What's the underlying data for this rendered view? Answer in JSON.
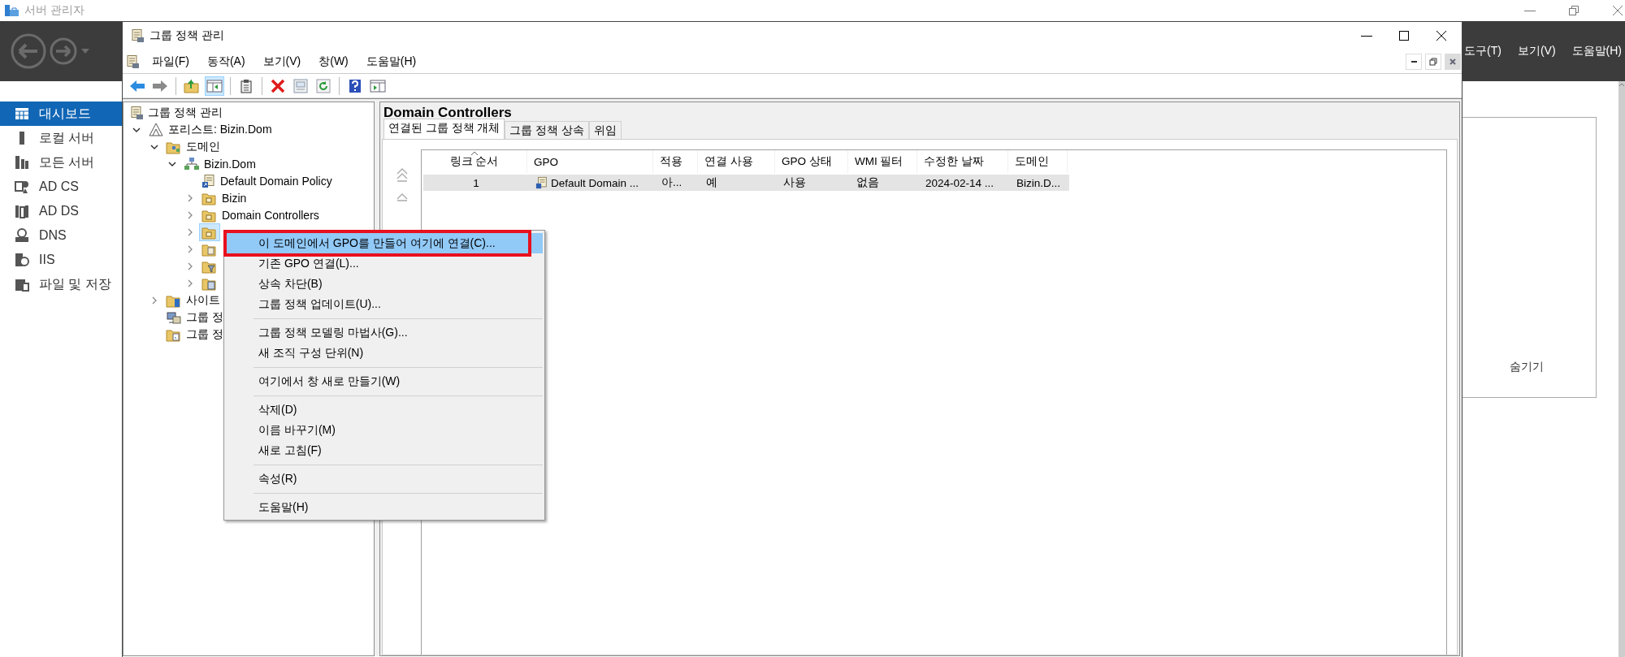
{
  "server_manager": {
    "title": "서버 관리자",
    "menu": [
      "도구(T)",
      "보기(V)",
      "도움말(H)"
    ],
    "sidebar": [
      {
        "label": "대시보드",
        "selected": true
      },
      {
        "label": "로컬 서버",
        "selected": false
      },
      {
        "label": "모든 서버",
        "selected": false
      },
      {
        "label": "AD CS",
        "selected": false
      },
      {
        "label": "AD DS",
        "selected": false
      },
      {
        "label": "DNS",
        "selected": false
      },
      {
        "label": "IIS",
        "selected": false
      },
      {
        "label": "파일 및 저장",
        "selected": false
      }
    ],
    "hide_link": "숨기기"
  },
  "gpm_window": {
    "title": "그룹 정책 관리",
    "menu": [
      "파일(F)",
      "동작(A)",
      "보기(V)",
      "창(W)",
      "도움말(H)"
    ],
    "toolbar": [
      {
        "kind": "back",
        "pressed": false
      },
      {
        "kind": "forward",
        "pressed": false
      },
      {
        "kind": "separator"
      },
      {
        "kind": "up",
        "pressed": false
      },
      {
        "kind": "console-tree",
        "pressed": true
      },
      {
        "kind": "separator"
      },
      {
        "kind": "export",
        "pressed": false
      },
      {
        "kind": "separator"
      },
      {
        "kind": "delete",
        "pressed": false
      },
      {
        "kind": "properties",
        "pressed": false
      },
      {
        "kind": "refresh",
        "pressed": false
      },
      {
        "kind": "separator"
      },
      {
        "kind": "help",
        "pressed": false
      },
      {
        "kind": "action-pane",
        "pressed": false
      }
    ],
    "tree": [
      {
        "kind": "console",
        "label": "그룹 정책 관리",
        "selected": false,
        "children": [
          {
            "kind": "forest",
            "label": "포리스트: Bizin.Dom",
            "expanded": true,
            "selected": false,
            "children": [
              {
                "kind": "domains",
                "label": "도메인",
                "expanded": true,
                "selected": false,
                "children": [
                  {
                    "kind": "domain",
                    "label": "Bizin.Dom",
                    "expanded": true,
                    "selected": false,
                    "children": [
                      {
                        "kind": "gpo-link",
                        "label": "Default Domain Policy",
                        "selected": false
                      },
                      {
                        "kind": "ou",
                        "label": "Bizin",
                        "expanded": false,
                        "selected": false
                      },
                      {
                        "kind": "ou",
                        "label": "Domain Controllers",
                        "expanded": false,
                        "selected": false
                      },
                      {
                        "kind": "ou",
                        "expanded": false,
                        "selected": true
                      },
                      {
                        "kind": "gpo-folder",
                        "expanded": false,
                        "selected": false
                      },
                      {
                        "kind": "filter-folder",
                        "expanded": false,
                        "selected": false
                      },
                      {
                        "kind": "starter-folder",
                        "expanded": false,
                        "selected": false
                      }
                    ]
                  }
                ]
              },
              {
                "kind": "sites",
                "label": "사이트",
                "expanded": false,
                "selected": false
              },
              {
                "kind": "modeling",
                "label": "그룹 정",
                "selected": false
              },
              {
                "kind": "results",
                "label": "그룹 정",
                "selected": false
              }
            ]
          }
        ]
      }
    ],
    "details": {
      "title": "Domain Controllers",
      "tabs": [
        {
          "label": "연결된 그룹 정책 개체",
          "selected": true
        },
        {
          "label": "그룹 정책 상속",
          "selected": false
        },
        {
          "label": "위임",
          "selected": false
        }
      ],
      "columns": [
        {
          "label": "링크 순서",
          "sorted": true
        },
        {
          "label": "GPO",
          "sorted": false
        },
        {
          "label": "적용",
          "sorted": false
        },
        {
          "label": "연결 사용",
          "sorted": false
        },
        {
          "label": "GPO 상태",
          "sorted": false
        },
        {
          "label": "WMI 필터",
          "sorted": false
        },
        {
          "label": "수정한 날짜",
          "sorted": false
        },
        {
          "label": "도메인",
          "sorted": false
        }
      ],
      "rows": [
        {
          "selected": true,
          "cells": [
            "1",
            "Default Domain ...",
            "아...",
            "예",
            "사용",
            "없음",
            "2024-02-14 ...",
            "Bizin.D..."
          ]
        }
      ]
    },
    "context_menu": [
      {
        "kind": "item",
        "label": "이 도메인에서 GPO를 만들어 여기에 연결(C)...",
        "highlighted": true,
        "marked": true
      },
      {
        "kind": "item",
        "label": "기존 GPO 연결(L)...",
        "highlighted": false,
        "marked": false
      },
      {
        "kind": "item",
        "label": "상속 차단(B)",
        "highlighted": false,
        "marked": false
      },
      {
        "kind": "item",
        "label": "그룹 정책 업데이트(U)...",
        "highlighted": false,
        "marked": false
      },
      {
        "kind": "separator"
      },
      {
        "kind": "item",
        "label": "그룹 정책 모델링 마법사(G)...",
        "highlighted": false,
        "marked": false
      },
      {
        "kind": "item",
        "label": "새 조직 구성 단위(N)",
        "highlighted": false,
        "marked": false
      },
      {
        "kind": "separator"
      },
      {
        "kind": "item",
        "label": "여기에서 창 새로 만들기(W)",
        "highlighted": false,
        "marked": false
      },
      {
        "kind": "separator"
      },
      {
        "kind": "item",
        "label": "삭제(D)",
        "highlighted": false,
        "marked": false
      },
      {
        "kind": "item",
        "label": "이름 바꾸기(M)",
        "highlighted": false,
        "marked": false
      },
      {
        "kind": "item",
        "label": "새로 고침(F)",
        "highlighted": false,
        "marked": false
      },
      {
        "kind": "separator"
      },
      {
        "kind": "item",
        "label": "속성(R)",
        "highlighted": false,
        "marked": false
      },
      {
        "kind": "separator"
      },
      {
        "kind": "item",
        "label": "도움말(H)",
        "highlighted": false,
        "marked": false
      }
    ]
  }
}
